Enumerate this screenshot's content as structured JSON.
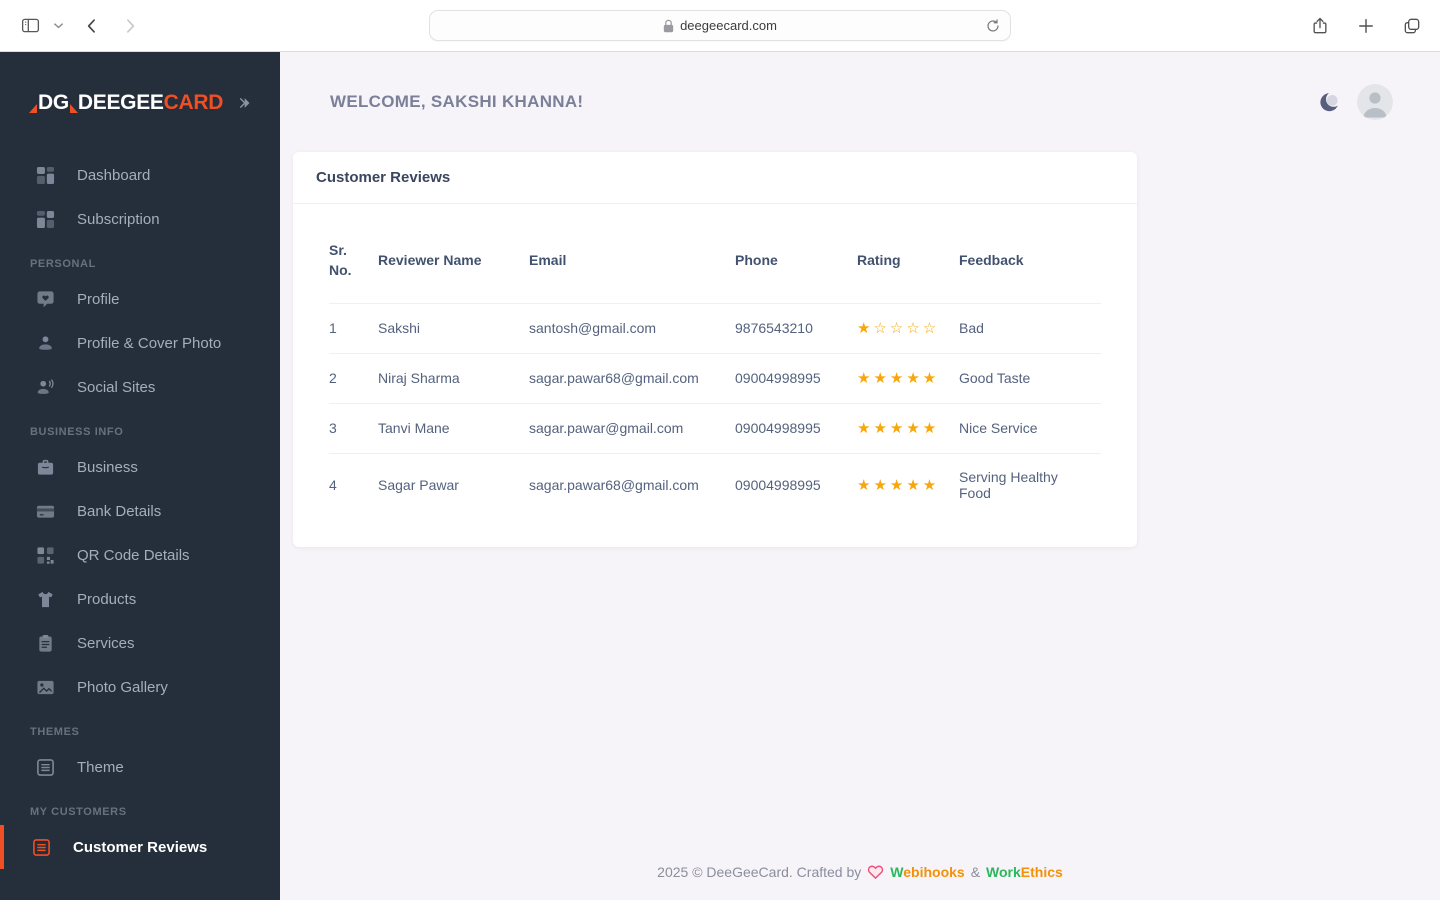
{
  "browser": {
    "url": "deegeecard.com"
  },
  "sidebar": {
    "logo": {
      "mark": "DG",
      "name_primary": "DEEGEE",
      "name_accent": "CARD"
    },
    "items": [
      {
        "type": "item",
        "label": "Dashboard",
        "icon": "dashboard-grid-icon"
      },
      {
        "type": "item",
        "label": "Subscription",
        "icon": "subscription-grid-icon"
      },
      {
        "type": "section",
        "label": "PERSONAL"
      },
      {
        "type": "item",
        "label": "Profile",
        "icon": "chat-heart-icon"
      },
      {
        "type": "item",
        "label": "Profile & Cover Photo",
        "icon": "person-icon"
      },
      {
        "type": "item",
        "label": "Social Sites",
        "icon": "person-voice-icon"
      },
      {
        "type": "section",
        "label": "BUSINESS INFO"
      },
      {
        "type": "item",
        "label": "Business",
        "icon": "briefcase-icon"
      },
      {
        "type": "item",
        "label": "Bank Details",
        "icon": "credit-card-icon"
      },
      {
        "type": "item",
        "label": "QR Code Details",
        "icon": "qr-code-icon"
      },
      {
        "type": "item",
        "label": "Products",
        "icon": "tshirt-icon"
      },
      {
        "type": "item",
        "label": "Services",
        "icon": "clipboard-icon"
      },
      {
        "type": "item",
        "label": "Photo Gallery",
        "icon": "photo-gallery-icon"
      },
      {
        "type": "section",
        "label": "THEMES"
      },
      {
        "type": "item",
        "label": "Theme",
        "icon": "list-box-icon"
      },
      {
        "type": "section",
        "label": "MY CUSTOMERS"
      },
      {
        "type": "item",
        "label": "Customer Reviews",
        "icon": "list-box-icon",
        "active": true
      }
    ]
  },
  "header": {
    "welcome": "WELCOME, SAKSHI KHANNA!"
  },
  "card": {
    "title": "Customer Reviews"
  },
  "table": {
    "columns": [
      "Sr. No.",
      "Reviewer Name",
      "Email",
      "Phone",
      "Rating",
      "Feedback"
    ],
    "rows": [
      {
        "sr": "1",
        "name": "Sakshi",
        "email": "santosh@gmail.com",
        "phone": "9876543210",
        "rating": 1,
        "feedback": "Bad"
      },
      {
        "sr": "2",
        "name": "Niraj Sharma",
        "email": "sagar.pawar68@gmail.com",
        "phone": "09004998995",
        "rating": 5,
        "feedback": "Good Taste"
      },
      {
        "sr": "3",
        "name": "Tanvi Mane",
        "email": "sagar.pawar@gmail.com",
        "phone": "09004998995",
        "rating": 5,
        "feedback": "Nice Service"
      },
      {
        "sr": "4",
        "name": "Sagar Pawar",
        "email": "sagar.pawar68@gmail.com",
        "phone": "09004998995",
        "rating": 5,
        "feedback": "Serving Healthy Food"
      }
    ],
    "rating_max": 5
  },
  "footer": {
    "text_prefix": "2025 © DeeGeeCard. Crafted by",
    "brand1_green": "W",
    "brand1_orange": "ebihooks",
    "separator": "&",
    "brand2_green": "Work",
    "brand2_orange": "Ethics"
  },
  "colors": {
    "accent_orange": "#f04e23",
    "star_gold": "#f7a70a",
    "footer_green": "#2bb85c",
    "footer_orange": "#f39208",
    "sidebar_bg": "#252e3b"
  }
}
